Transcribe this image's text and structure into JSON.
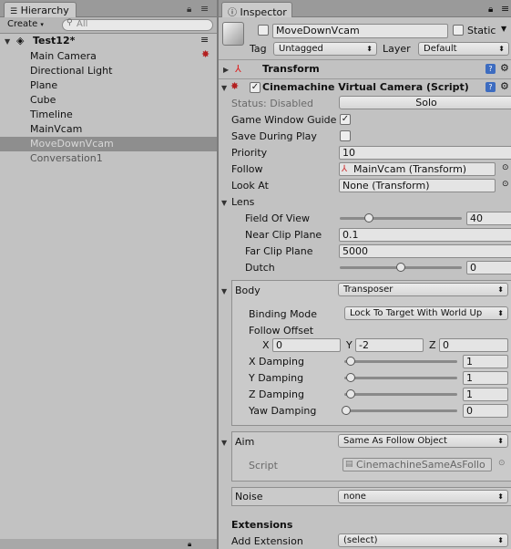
{
  "hierarchy": {
    "tab_label": "Hierarchy",
    "create_label": "Create",
    "search_placeholder": "All",
    "scene_name": "Test12*",
    "items": [
      {
        "label": "Main Camera",
        "selected": false,
        "dimmed": false
      },
      {
        "label": "Directional Light",
        "selected": false,
        "dimmed": false
      },
      {
        "label": "Plane",
        "selected": false,
        "dimmed": false
      },
      {
        "label": "Cube",
        "selected": false,
        "dimmed": false
      },
      {
        "label": "Timeline",
        "selected": false,
        "dimmed": false
      },
      {
        "label": "MainVcam",
        "selected": false,
        "dimmed": false
      },
      {
        "label": "MoveDownVcam",
        "selected": true,
        "dimmed": true
      },
      {
        "label": "Conversation1",
        "selected": false,
        "dimmed": true
      }
    ]
  },
  "inspector": {
    "tab_label": "Inspector",
    "object_name": "MoveDownVcam",
    "static_label": "Static",
    "tag_label": "Tag",
    "tag_value": "Untagged",
    "layer_label": "Layer",
    "layer_value": "Default",
    "transform_title": "Transform",
    "vcam_title": "Cinemachine Virtual Camera (Script)",
    "status_label": "Status: Disabled",
    "solo_label": "Solo",
    "game_window_guides_label": "Game Window Guide",
    "game_window_guides_checked": true,
    "save_during_play_label": "Save During Play",
    "save_during_play_checked": false,
    "priority_label": "Priority",
    "priority_value": "10",
    "follow_label": "Follow",
    "follow_value": "MainVcam (Transform)",
    "look_at_label": "Look At",
    "look_at_value": "None (Transform)",
    "lens_label": "Lens",
    "fov_label": "Field Of View",
    "fov_value": "40",
    "fov_fraction": 0.24,
    "near_label": "Near Clip Plane",
    "near_value": "0.1",
    "far_label": "Far Clip Plane",
    "far_value": "5000",
    "dutch_label": "Dutch",
    "dutch_value": "0",
    "dutch_fraction": 0.5,
    "body_label": "Body",
    "body_value": "Transposer",
    "binding_mode_label": "Binding Mode",
    "binding_mode_value": "Lock To Target With World Up",
    "follow_offset_label": "Follow Offset",
    "offset_x_label": "X",
    "offset_x": "0",
    "offset_y_label": "Y",
    "offset_y": "-2",
    "offset_z_label": "Z",
    "offset_z": "0",
    "x_damping_label": "X Damping",
    "x_damping": "1",
    "y_damping_label": "Y Damping",
    "y_damping": "1",
    "z_damping_label": "Z Damping",
    "z_damping": "1",
    "yaw_damping_label": "Yaw Damping",
    "yaw_damping": "0",
    "aim_label": "Aim",
    "aim_value": "Same As Follow Object",
    "script_label": "Script",
    "script_value": "CinemachineSameAsFollo",
    "noise_label": "Noise",
    "noise_value": "none",
    "extensions_label": "Extensions",
    "add_extension_label": "Add Extension",
    "add_extension_value": "(select)"
  },
  "colors": {
    "selection": "#8e8e8e",
    "panel": "#c2c2c2",
    "header": "#9a9a9a"
  }
}
